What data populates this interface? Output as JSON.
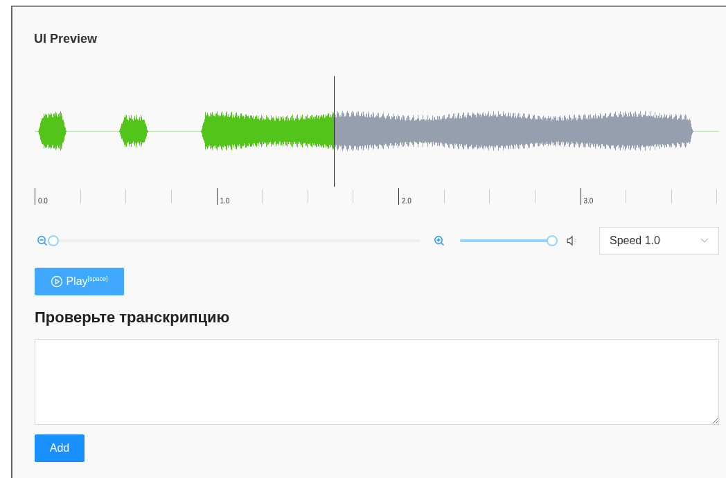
{
  "title": "UI Preview",
  "waveform": {
    "level": 0.437
  },
  "timeline": {
    "labels": [
      "0.0",
      "1.0",
      "2.0",
      "3.0"
    ]
  },
  "zoom": {
    "level": 0
  },
  "volume": {
    "level": 1
  },
  "speed": {
    "value": "Speed 1.0"
  },
  "play_button": {
    "label": "Play",
    "shortcut": "[space]"
  },
  "heading": "Проверьте транскрипцию",
  "add_button": "Add"
}
